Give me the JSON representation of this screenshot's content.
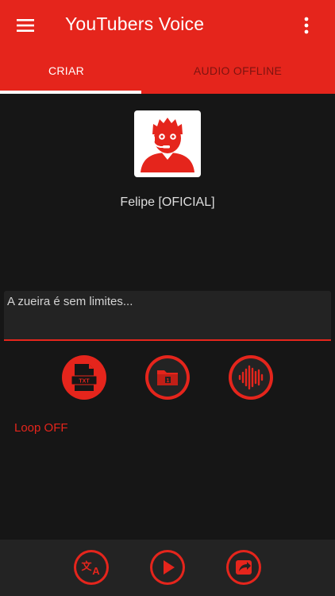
{
  "app": {
    "title": "YouTubers Voice"
  },
  "tabs": [
    {
      "label": "CRIAR",
      "active": true
    },
    {
      "label": "AUDIO OFFLINE",
      "active": false
    }
  ],
  "profile": {
    "name": "Felipe [OFICIAL]",
    "avatar_icon": "person-headset-icon"
  },
  "input": {
    "value": "A zueira é sem limites..."
  },
  "actions": [
    {
      "icon": "txt-file-icon"
    },
    {
      "icon": "folder-icon"
    },
    {
      "icon": "waveform-icon"
    }
  ],
  "loop": {
    "label": "Loop OFF"
  },
  "bottom_actions": [
    {
      "icon": "translate-icon"
    },
    {
      "icon": "play-icon"
    },
    {
      "icon": "share-icon"
    }
  ],
  "colors": {
    "accent": "#e5251c",
    "background": "#161616",
    "surface": "#232323"
  }
}
